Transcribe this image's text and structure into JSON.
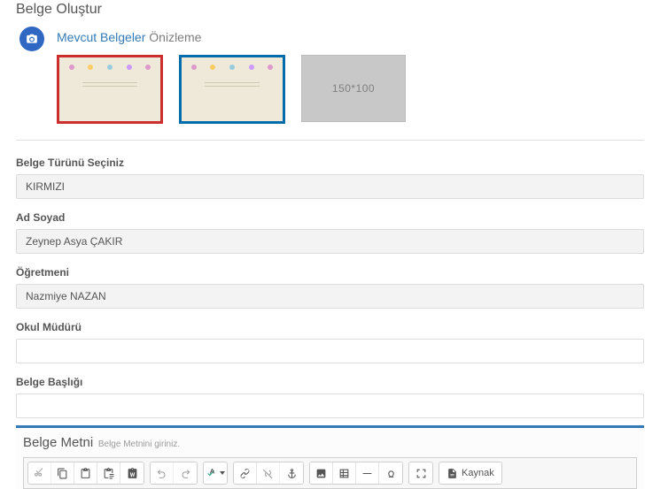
{
  "page": {
    "title": "Belge Oluştur"
  },
  "timeline": {
    "link_text": "Mevcut Belgeler",
    "after_text": "Önizleme",
    "placeholder_label": "150*100"
  },
  "form": {
    "type": {
      "label": "Belge Türünü Seçiniz",
      "value": "KIRMIZI"
    },
    "name": {
      "label": "Ad Soyad",
      "value": "Zeynep Asya ÇAKIR"
    },
    "teacher": {
      "label": "Öğretmeni",
      "value": "Nazmiye NAZAN"
    },
    "principal": {
      "label": "Okul Müdürü",
      "value": ""
    },
    "doc_title": {
      "label": "Belge Başlığı",
      "value": ""
    }
  },
  "editor": {
    "title": "Belge Metni",
    "hint": "Belge Metnini giriniz.",
    "source_label": "Kaynak"
  }
}
